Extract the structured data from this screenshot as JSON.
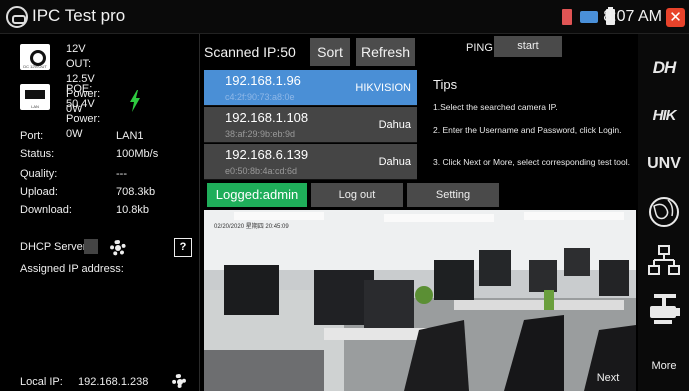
{
  "titlebar": {
    "title": "IPC Test pro",
    "time": "8:07 AM",
    "close_label": "✕"
  },
  "left": {
    "dc_out": {
      "icon_text": "DC 12V/OUT",
      "voltage": "12V OUT: 12.5V",
      "power": "Power: 0W"
    },
    "poe": {
      "icon_text": "LAN",
      "voltage": "POE: 50.4V",
      "power": "Power: 0W"
    },
    "stats": [
      {
        "label": "Port:",
        "value": "LAN1"
      },
      {
        "label": "Status:",
        "value": "100Mb/s"
      },
      {
        "label": "Quality:",
        "value": "---"
      },
      {
        "label": "Upload:",
        "value": "708.3kb"
      },
      {
        "label": "Download:",
        "value": "10.8kb"
      }
    ],
    "dhcp_label": "DHCP Server:",
    "help_label": "?",
    "assigned_label": "Assigned IP address:",
    "local_ip_label": "Local IP:",
    "local_ip_value": "192.168.1.238"
  },
  "scan": {
    "title": "Scanned IP:50",
    "sort_label": "Sort",
    "refresh_label": "Refresh"
  },
  "devices": [
    {
      "ip": "192.168.1.96",
      "mac": "c4:2f:90:73:a8:0e",
      "vendor": "HIKVISION",
      "selected": true
    },
    {
      "ip": "192.168.1.108",
      "mac": "38:af:29:9b:eb:9d",
      "vendor": "Dahua",
      "selected": false
    },
    {
      "ip": "192.168.6.139",
      "mac": "e0:50:8b:4a:cd:6d",
      "vendor": "Dahua",
      "selected": false
    }
  ],
  "ping": {
    "label": "PING",
    "start_label": "start"
  },
  "tips": {
    "title": "Tips",
    "items": [
      "1.Select the searched camera IP.",
      "2. Enter the Username and Password, click Login.",
      "3. Click Next or More, select corresponding test tool."
    ]
  },
  "actions": {
    "login_state": "Logged:admin",
    "logout_label": "Log out",
    "setting_label": "Setting",
    "next_label": "Next"
  },
  "video": {
    "timestamp": "02/20/2020 星期四 20:45:09"
  },
  "sidebar": {
    "dh_label": "DH",
    "hik_label": "HIK",
    "unv_label": "UNV",
    "more_label": "More"
  },
  "colors": {
    "selected_row": "#4a8fd6",
    "logged_in": "#1fae5a",
    "close": "#e8432b",
    "bolt": "#2ecc40"
  }
}
